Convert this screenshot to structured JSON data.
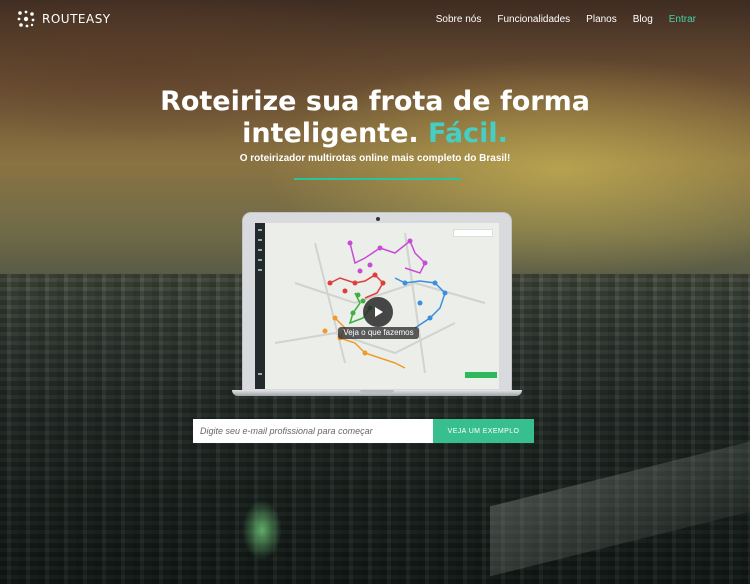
{
  "brand": {
    "logo_text": "ROUTEASY"
  },
  "nav": {
    "items": [
      "Sobre nós",
      "Funcionalidades",
      "Planos",
      "Blog"
    ],
    "login": "Entrar"
  },
  "hero": {
    "headline_line1": "Roteirize sua frota de forma",
    "headline_line2": "inteligente.",
    "headline_accent": "Fácil.",
    "subheadline": "O roteirizador multirotas online mais completo do Brasil!"
  },
  "video": {
    "caption": "Veja o que fazemos"
  },
  "signup": {
    "email_placeholder": "Digite seu e-mail profissional para começar",
    "email_value": "",
    "button_label": "VEJA UM EXEMPLO"
  },
  "colors": {
    "accent": "#45cfc4",
    "cta": "#37bf90",
    "nav_accent": "#47d1a4"
  }
}
